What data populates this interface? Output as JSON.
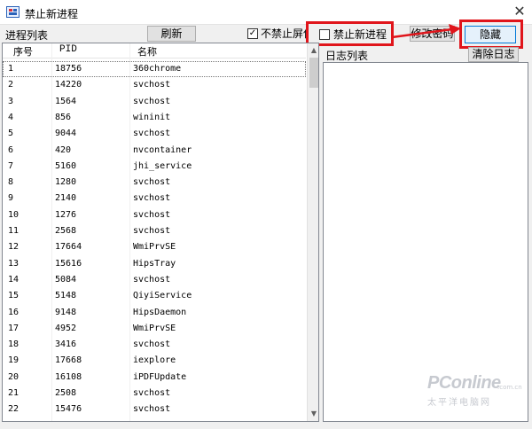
{
  "window": {
    "title": "禁止新进程",
    "close_glyph": "✕",
    "icon": "app-window-icon"
  },
  "toolbar": {
    "process_list_label": "进程列表",
    "refresh_label": "刷新",
    "block_screen_label": "不禁止屏保",
    "block_screen_checked": true,
    "block_new_process_label": "禁止新进程",
    "block_new_process_checked": false,
    "change_password_label": "修改密码",
    "hide_label": "隐藏"
  },
  "process_table": {
    "columns": [
      "序号",
      "PID",
      "名称"
    ],
    "rows": [
      [
        "1",
        "18756",
        "360chrome"
      ],
      [
        "2",
        "14220",
        "svchost"
      ],
      [
        "3",
        "1564",
        "svchost"
      ],
      [
        "4",
        "856",
        "wininit"
      ],
      [
        "5",
        "9044",
        "svchost"
      ],
      [
        "6",
        "420",
        "nvcontainer"
      ],
      [
        "7",
        "5160",
        "jhi_service"
      ],
      [
        "8",
        "1280",
        "svchost"
      ],
      [
        "9",
        "2140",
        "svchost"
      ],
      [
        "10",
        "1276",
        "svchost"
      ],
      [
        "11",
        "2568",
        "svchost"
      ],
      [
        "12",
        "17664",
        "WmiPrvSE"
      ],
      [
        "13",
        "15616",
        "HipsTray"
      ],
      [
        "14",
        "5084",
        "svchost"
      ],
      [
        "15",
        "5148",
        "QiyiService"
      ],
      [
        "16",
        "9148",
        "HipsDaemon"
      ],
      [
        "17",
        "4952",
        "WmiPrvSE"
      ],
      [
        "18",
        "3416",
        "svchost"
      ],
      [
        "19",
        "17668",
        "iexplore"
      ],
      [
        "20",
        "16108",
        "iPDFUpdate"
      ],
      [
        "21",
        "2508",
        "svchost"
      ],
      [
        "22",
        "15476",
        "svchost"
      ]
    ]
  },
  "log": {
    "label": "日志列表",
    "clear_label": "清除日志"
  },
  "watermark": {
    "logo": "PConline",
    "subtitle": "太平洋电脑网",
    "suffix": ".com.cn"
  },
  "colors": {
    "highlight_frame": "#e0151b",
    "background": "#f0f0f0"
  }
}
